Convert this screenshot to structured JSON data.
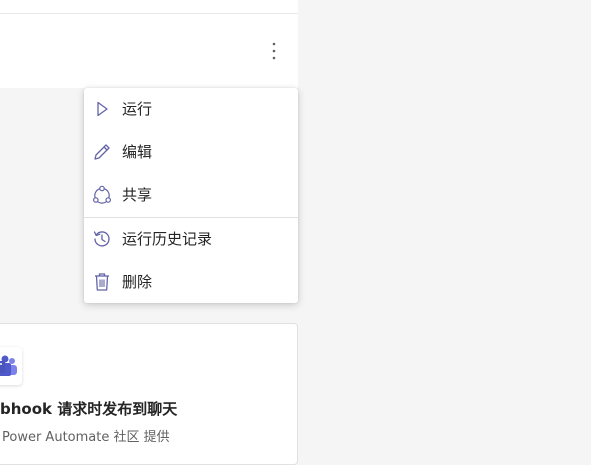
{
  "colors": {
    "accent": "#6264a7",
    "text": "#242424",
    "subtext": "#616161",
    "background": "#f5f5f5"
  },
  "header": {
    "more_icon": "more-vertical-icon"
  },
  "menu": {
    "items": [
      {
        "label": "运行",
        "icon": "play-icon"
      },
      {
        "label": "编辑",
        "icon": "pencil-icon"
      },
      {
        "label": "共享",
        "icon": "share-icon"
      },
      {
        "label": "运行历史记录",
        "icon": "history-icon"
      },
      {
        "label": "删除",
        "icon": "trash-icon"
      }
    ]
  },
  "card": {
    "icon": "teams-icon",
    "title": "bhook 请求时发布到聊天",
    "subtitle": "Power Automate 社区 提供"
  }
}
